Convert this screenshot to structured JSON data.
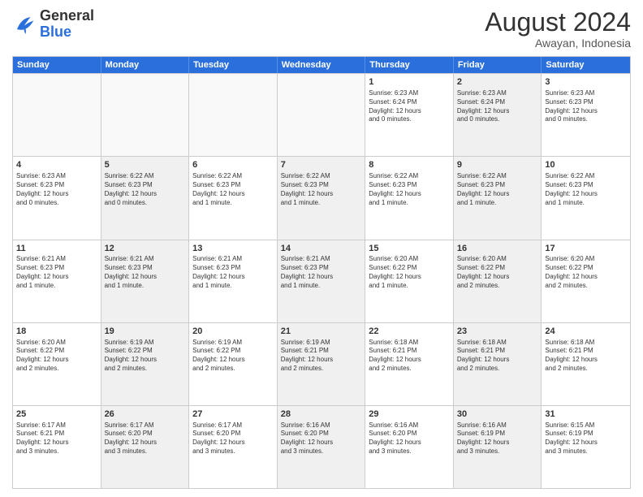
{
  "header": {
    "logo_general": "General",
    "logo_blue": "Blue",
    "month_year": "August 2024",
    "location": "Awayan, Indonesia"
  },
  "days_of_week": [
    "Sunday",
    "Monday",
    "Tuesday",
    "Wednesday",
    "Thursday",
    "Friday",
    "Saturday"
  ],
  "rows": [
    [
      {
        "day": "",
        "info": "",
        "empty": true
      },
      {
        "day": "",
        "info": "",
        "empty": true
      },
      {
        "day": "",
        "info": "",
        "empty": true
      },
      {
        "day": "",
        "info": "",
        "empty": true
      },
      {
        "day": "1",
        "info": "Sunrise: 6:23 AM\nSunset: 6:24 PM\nDaylight: 12 hours\nand 0 minutes.",
        "shaded": false
      },
      {
        "day": "2",
        "info": "Sunrise: 6:23 AM\nSunset: 6:24 PM\nDaylight: 12 hours\nand 0 minutes.",
        "shaded": true
      },
      {
        "day": "3",
        "info": "Sunrise: 6:23 AM\nSunset: 6:23 PM\nDaylight: 12 hours\nand 0 minutes.",
        "shaded": false
      }
    ],
    [
      {
        "day": "4",
        "info": "Sunrise: 6:23 AM\nSunset: 6:23 PM\nDaylight: 12 hours\nand 0 minutes.",
        "shaded": false
      },
      {
        "day": "5",
        "info": "Sunrise: 6:22 AM\nSunset: 6:23 PM\nDaylight: 12 hours\nand 0 minutes.",
        "shaded": true
      },
      {
        "day": "6",
        "info": "Sunrise: 6:22 AM\nSunset: 6:23 PM\nDaylight: 12 hours\nand 1 minute.",
        "shaded": false
      },
      {
        "day": "7",
        "info": "Sunrise: 6:22 AM\nSunset: 6:23 PM\nDaylight: 12 hours\nand 1 minute.",
        "shaded": true
      },
      {
        "day": "8",
        "info": "Sunrise: 6:22 AM\nSunset: 6:23 PM\nDaylight: 12 hours\nand 1 minute.",
        "shaded": false
      },
      {
        "day": "9",
        "info": "Sunrise: 6:22 AM\nSunset: 6:23 PM\nDaylight: 12 hours\nand 1 minute.",
        "shaded": true
      },
      {
        "day": "10",
        "info": "Sunrise: 6:22 AM\nSunset: 6:23 PM\nDaylight: 12 hours\nand 1 minute.",
        "shaded": false
      }
    ],
    [
      {
        "day": "11",
        "info": "Sunrise: 6:21 AM\nSunset: 6:23 PM\nDaylight: 12 hours\nand 1 minute.",
        "shaded": false
      },
      {
        "day": "12",
        "info": "Sunrise: 6:21 AM\nSunset: 6:23 PM\nDaylight: 12 hours\nand 1 minute.",
        "shaded": true
      },
      {
        "day": "13",
        "info": "Sunrise: 6:21 AM\nSunset: 6:23 PM\nDaylight: 12 hours\nand 1 minute.",
        "shaded": false
      },
      {
        "day": "14",
        "info": "Sunrise: 6:21 AM\nSunset: 6:23 PM\nDaylight: 12 hours\nand 1 minute.",
        "shaded": true
      },
      {
        "day": "15",
        "info": "Sunrise: 6:20 AM\nSunset: 6:22 PM\nDaylight: 12 hours\nand 1 minute.",
        "shaded": false
      },
      {
        "day": "16",
        "info": "Sunrise: 6:20 AM\nSunset: 6:22 PM\nDaylight: 12 hours\nand 2 minutes.",
        "shaded": true
      },
      {
        "day": "17",
        "info": "Sunrise: 6:20 AM\nSunset: 6:22 PM\nDaylight: 12 hours\nand 2 minutes.",
        "shaded": false
      }
    ],
    [
      {
        "day": "18",
        "info": "Sunrise: 6:20 AM\nSunset: 6:22 PM\nDaylight: 12 hours\nand 2 minutes.",
        "shaded": false
      },
      {
        "day": "19",
        "info": "Sunrise: 6:19 AM\nSunset: 6:22 PM\nDaylight: 12 hours\nand 2 minutes.",
        "shaded": true
      },
      {
        "day": "20",
        "info": "Sunrise: 6:19 AM\nSunset: 6:22 PM\nDaylight: 12 hours\nand 2 minutes.",
        "shaded": false
      },
      {
        "day": "21",
        "info": "Sunrise: 6:19 AM\nSunset: 6:21 PM\nDaylight: 12 hours\nand 2 minutes.",
        "shaded": true
      },
      {
        "day": "22",
        "info": "Sunrise: 6:18 AM\nSunset: 6:21 PM\nDaylight: 12 hours\nand 2 minutes.",
        "shaded": false
      },
      {
        "day": "23",
        "info": "Sunrise: 6:18 AM\nSunset: 6:21 PM\nDaylight: 12 hours\nand 2 minutes.",
        "shaded": true
      },
      {
        "day": "24",
        "info": "Sunrise: 6:18 AM\nSunset: 6:21 PM\nDaylight: 12 hours\nand 2 minutes.",
        "shaded": false
      }
    ],
    [
      {
        "day": "25",
        "info": "Sunrise: 6:17 AM\nSunset: 6:21 PM\nDaylight: 12 hours\nand 3 minutes.",
        "shaded": false
      },
      {
        "day": "26",
        "info": "Sunrise: 6:17 AM\nSunset: 6:20 PM\nDaylight: 12 hours\nand 3 minutes.",
        "shaded": true
      },
      {
        "day": "27",
        "info": "Sunrise: 6:17 AM\nSunset: 6:20 PM\nDaylight: 12 hours\nand 3 minutes.",
        "shaded": false
      },
      {
        "day": "28",
        "info": "Sunrise: 6:16 AM\nSunset: 6:20 PM\nDaylight: 12 hours\nand 3 minutes.",
        "shaded": true
      },
      {
        "day": "29",
        "info": "Sunrise: 6:16 AM\nSunset: 6:20 PM\nDaylight: 12 hours\nand 3 minutes.",
        "shaded": false
      },
      {
        "day": "30",
        "info": "Sunrise: 6:16 AM\nSunset: 6:19 PM\nDaylight: 12 hours\nand 3 minutes.",
        "shaded": true
      },
      {
        "day": "31",
        "info": "Sunrise: 6:15 AM\nSunset: 6:19 PM\nDaylight: 12 hours\nand 3 minutes.",
        "shaded": false
      }
    ]
  ]
}
